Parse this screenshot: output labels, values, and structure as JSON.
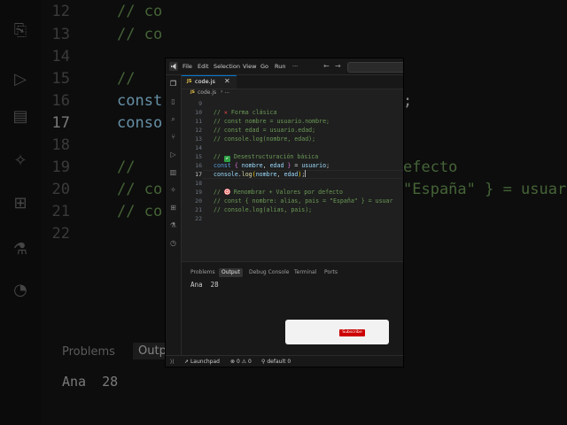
{
  "menu": [
    "File",
    "Edit",
    "Selection",
    "View",
    "Go",
    "Run",
    "···"
  ],
  "nav": {
    "back": "←",
    "forward": "→"
  },
  "tab": {
    "icon_text": "JS",
    "name": "code.js",
    "close": "✕"
  },
  "breadcrumb": {
    "icon_text": "JS",
    "file": "code.js",
    "sep": "›",
    "rest": "..."
  },
  "editor": {
    "line_numbers": [
      "9",
      "10",
      "11",
      "12",
      "13",
      "14",
      "15",
      "16",
      "17",
      "18",
      "19",
      "20",
      "21",
      "22"
    ],
    "current_line": "17",
    "lines": {
      "l10": {
        "pre": "// ",
        "emoji": "✕",
        "text": " Forma clásica"
      },
      "l11": "// const nombre = usuario.nombre;",
      "l12": "// const edad = usuario.edad;",
      "l13": "// console.log(nombre, edad);",
      "l15": {
        "pre": "// ",
        "emoji": "✔",
        "text": " Desestructuración básica"
      },
      "l16": {
        "kw": "const",
        "open": " { ",
        "a": "nombre",
        "comma": ", ",
        "b": "edad",
        "close": " } ",
        "eq": "= ",
        "src": "usuario",
        "semi": ";"
      },
      "l17": {
        "obj": "console",
        "dot": ".",
        "fn": "log",
        "open": "(",
        "a": "nombre",
        "comma": ", ",
        "b": "edad",
        "close": ")",
        "semi": ";"
      },
      "l19": {
        "pre": "// ",
        "text": " Renombrar + Valores por defecto"
      },
      "l20": "// const { nombre: alias, pais = \"España\" } = usuar",
      "l21": "// console.log(alias, pais);"
    }
  },
  "panel": {
    "tabs": [
      "Problems",
      "Output",
      "Debug Console",
      "Terminal",
      "Ports"
    ],
    "active_tab": "Output",
    "output": "Ana  28"
  },
  "status": {
    "remote": "⟩⟨",
    "launchpad": "Launchpad",
    "errors": "0",
    "warnings": "0",
    "ports": "default 0"
  },
  "subscribe": {
    "label": "Subscribe"
  },
  "background": {
    "line_numbers": [
      "12",
      "13",
      "14",
      "15",
      "16",
      "17",
      "18",
      "19",
      "20",
      "21",
      "22"
    ],
    "lines": {
      "l12": "// co",
      "l13": "// co",
      "l15": "//",
      "l16": "const",
      "l17": "conso",
      "l19": "//",
      "l20": "// co",
      "l21": "// co"
    },
    "right_text": {
      "semi": ";",
      "defecto": "efecto",
      "espana": "\"España\" } = usuar"
    },
    "panel": {
      "problems": "Problems",
      "output": "Outp",
      "value": "Ana  28"
    }
  },
  "colors": {
    "accent": "#0078d4",
    "comment": "#6a9955",
    "keyword": "#569cd6",
    "variable": "#9cdcfe",
    "function": "#dcdcaa",
    "brace": "#da70d6",
    "paren": "#ffd700",
    "subscribe": "#cc0000"
  }
}
